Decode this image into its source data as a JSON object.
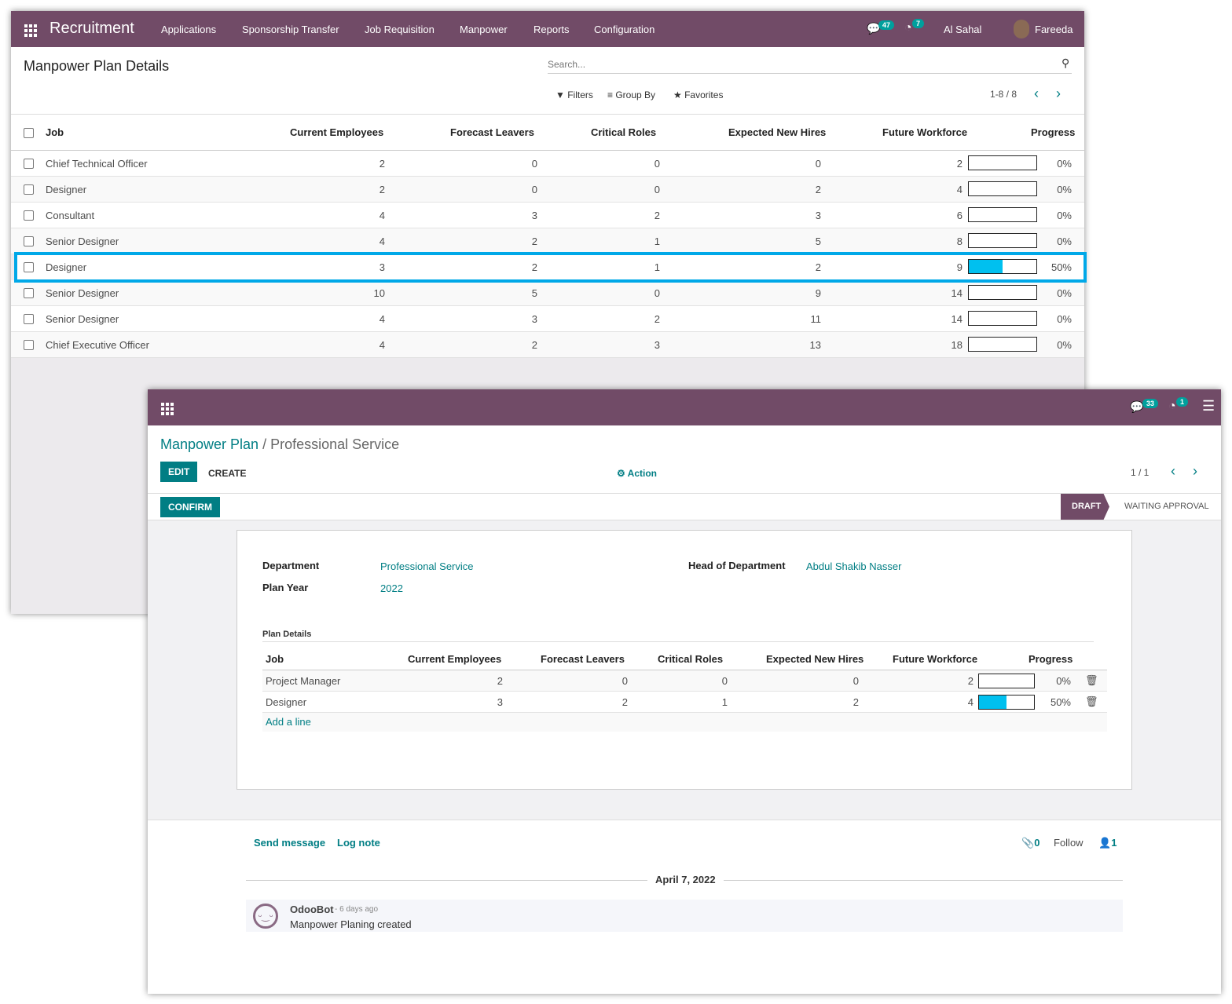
{
  "list_window": {
    "app_name": "Recruitment",
    "menu": [
      "Applications",
      "Sponsorship Transfer",
      "Job Requisition",
      "Manpower",
      "Reports",
      "Configuration"
    ],
    "messages_count": "47",
    "activities_count": "7",
    "company": "Al Sahal",
    "user": "Fareeda",
    "title": "Manpower Plan Details",
    "search_placeholder": "Search...",
    "filters": "Filters",
    "group_by": "Group By",
    "favorites": "Favorites",
    "pager": "1-8 / 8",
    "columns": [
      "Job",
      "Current Employees",
      "Forecast Leavers",
      "Critical Roles",
      "Expected New Hires",
      "Future Workforce",
      "Progress"
    ],
    "rows": [
      {
        "job": "Chief Technical Officer",
        "current": 2,
        "leavers": 0,
        "critical": 0,
        "hires": 0,
        "future": 2,
        "progress": 0
      },
      {
        "job": "Designer",
        "current": 2,
        "leavers": 0,
        "critical": 0,
        "hires": 2,
        "future": 4,
        "progress": 0
      },
      {
        "job": "Consultant",
        "current": 4,
        "leavers": 3,
        "critical": 2,
        "hires": 3,
        "future": 6,
        "progress": 0
      },
      {
        "job": "Senior Designer",
        "current": 4,
        "leavers": 2,
        "critical": 1,
        "hires": 5,
        "future": 8,
        "progress": 0
      },
      {
        "job": "Designer",
        "current": 3,
        "leavers": 2,
        "critical": 1,
        "hires": 2,
        "future": 9,
        "progress": 50,
        "highlighted": true
      },
      {
        "job": "Senior Designer",
        "current": 10,
        "leavers": 5,
        "critical": 0,
        "hires": 9,
        "future": 14,
        "progress": 0
      },
      {
        "job": "Senior Designer",
        "current": 4,
        "leavers": 3,
        "critical": 2,
        "hires": 11,
        "future": 14,
        "progress": 0
      },
      {
        "job": "Chief Executive Officer",
        "current": 4,
        "leavers": 2,
        "critical": 3,
        "hires": 13,
        "future": 18,
        "progress": 0
      }
    ]
  },
  "form_window": {
    "messages_count": "33",
    "activities_count": "1",
    "breadcrumb_parent": "Manpower Plan",
    "breadcrumb_current": "Professional Service",
    "edit": "EDIT",
    "create": "CREATE",
    "action": "Action",
    "pager": "1 / 1",
    "confirm": "CONFIRM",
    "status_draft": "DRAFT",
    "status_waiting": "WAITING APPROVAL",
    "department_label": "Department",
    "department": "Professional Service",
    "head_label": "Head of Department",
    "head": "Abdul Shakib Nasser",
    "plan_year_label": "Plan Year",
    "plan_year": "2022",
    "plan_details_label": "Plan Details",
    "columns": [
      "Job",
      "Current Employees",
      "Forecast Leavers",
      "Critical Roles",
      "Expected New Hires",
      "Future Workforce",
      "Progress"
    ],
    "rows": [
      {
        "job": "Project Manager",
        "current": 2,
        "leavers": 0,
        "critical": 0,
        "hires": 0,
        "future": 2,
        "progress": 0
      },
      {
        "job": "Designer",
        "current": 3,
        "leavers": 2,
        "critical": 1,
        "hires": 2,
        "future": 4,
        "progress": 50
      }
    ],
    "add_line": "Add a line",
    "send_message": "Send message",
    "log_note": "Log note",
    "attachments": "0",
    "follow": "Follow",
    "followers": "1",
    "date_separator": "April 7, 2022",
    "message_author": "OdooBot",
    "message_time": "- 6 days ago",
    "message_body": "Manpower Planing created"
  },
  "colors": {
    "navbar": "#714b67",
    "accent": "#017e84",
    "progress": "#00c0ef",
    "highlight": "#00a8e8"
  }
}
